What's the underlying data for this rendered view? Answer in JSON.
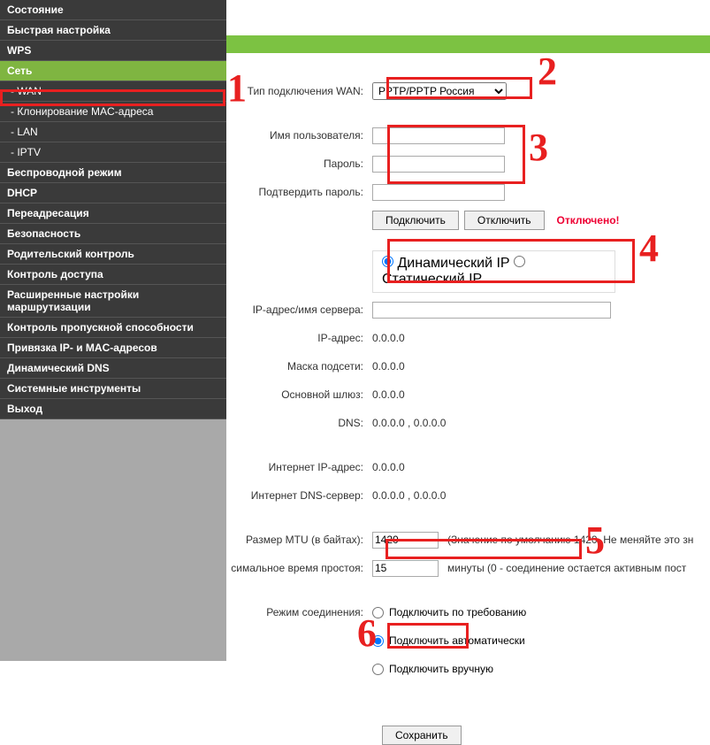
{
  "sidebar": {
    "items": [
      {
        "label": "Состояние"
      },
      {
        "label": "Быстрая настройка"
      },
      {
        "label": "WPS"
      },
      {
        "label": "Сеть",
        "active": true
      },
      {
        "label": "- WAN",
        "indent": true
      },
      {
        "label": "- Клонирование MAC-адреса",
        "indent": true
      },
      {
        "label": "- LAN",
        "indent": true
      },
      {
        "label": "- IPTV",
        "indent": true
      },
      {
        "label": "Беспроводной режим"
      },
      {
        "label": "DHCP"
      },
      {
        "label": "Переадресация"
      },
      {
        "label": "Безопасность"
      },
      {
        "label": "Родительский контроль"
      },
      {
        "label": "Контроль доступа"
      },
      {
        "label": "Расширенные настройки маршрутизации"
      },
      {
        "label": "Контроль пропускной способности"
      },
      {
        "label": "Привязка IP- и MAC-адресов"
      },
      {
        "label": "Динамический DNS"
      },
      {
        "label": "Системные инструменты"
      },
      {
        "label": "Выход"
      }
    ]
  },
  "labels": {
    "wan_type": "Тип подключения WAN:",
    "username": "Имя пользователя:",
    "password": "Пароль:",
    "confirm_password": "Подтвердить пароль:",
    "server": "IP-адрес/имя сервера:",
    "ip": "IP-адрес:",
    "mask": "Маска подсети:",
    "gateway": "Основной шлюз:",
    "dns": "DNS:",
    "inet_ip": "Интернет IP-адрес:",
    "inet_dns": "Интернет DNS-сервер:",
    "mtu": "Размер MTU (в байтах):",
    "idle": "симальное время простоя:",
    "conn_mode": "Режим соединения:"
  },
  "wan_select": "PPTP/PPTP Россия",
  "btn_connect": "Подключить",
  "btn_disconnect": "Отключить",
  "status_disconnected": "Отключено!",
  "radio_dynamic": "Динамический IP",
  "radio_static": "Статический IP",
  "values": {
    "ip": "0.0.0.0",
    "mask": "0.0.0.0",
    "gateway": "0.0.0.0",
    "dns": "0.0.0.0 , 0.0.0.0",
    "inet_ip": "0.0.0.0",
    "inet_dns": "0.0.0.0 , 0.0.0.0",
    "mtu": "1420",
    "idle": "15"
  },
  "hints": {
    "mtu": "(Значение по умолчанию 1420. Не меняйте это зн",
    "idle": "минуты (0 - соединение остается активным пост"
  },
  "conn_modes": {
    "on_demand": "Подключить по требованию",
    "auto": "Подключить автоматически",
    "manual": "Подключить вручную"
  },
  "btn_save": "Сохранить",
  "annotations": {
    "n1": "1",
    "n2": "2",
    "n3": "3",
    "n4": "4",
    "n5": "5",
    "n6": "6"
  }
}
